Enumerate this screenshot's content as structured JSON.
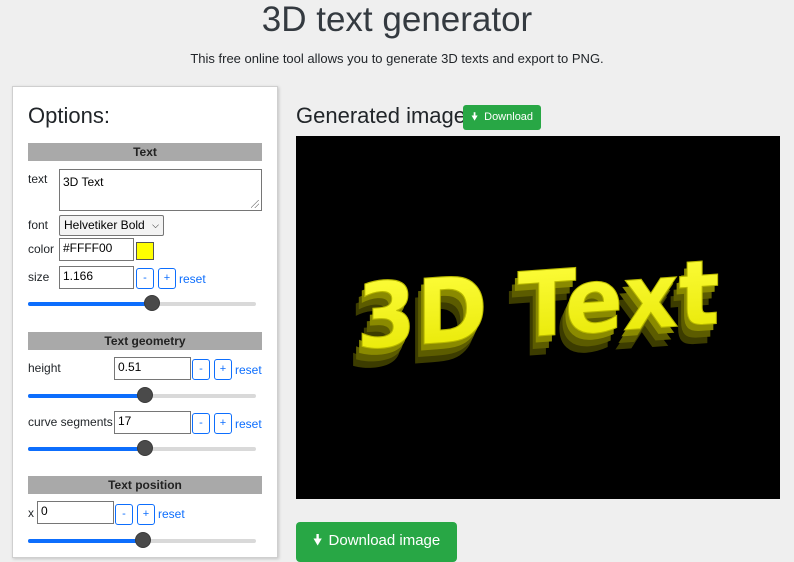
{
  "header": {
    "title": "3D text generator",
    "subtitle": "This free online tool allows you to generate 3D texts and export to PNG."
  },
  "options": {
    "heading": "Options:",
    "sections": {
      "text": "Text",
      "geometry": "Text geometry",
      "position": "Text position"
    },
    "text": {
      "label": "text",
      "value": "3D Text"
    },
    "font": {
      "label": "font",
      "value": "Helvetiker Bold"
    },
    "color": {
      "label": "color",
      "value": "#FFFF00",
      "swatch": "#FFFF00"
    },
    "size": {
      "label": "size",
      "value": "1.166",
      "slider_fraction": 0.54
    },
    "height": {
      "label": "height",
      "value": "0.51",
      "slider_fraction": 0.51
    },
    "curve_segments": {
      "label": "curve segments",
      "value": "17",
      "slider_fraction": 0.51
    },
    "x": {
      "label": "x",
      "value": "0",
      "slider_fraction": 0.5
    },
    "minus": "-",
    "plus": "+",
    "reset": "reset"
  },
  "generated": {
    "title": "Generated image",
    "download_small": "Download",
    "download_large": "Download image",
    "rendered_text": "3D Text",
    "text_color": "#FFFF00",
    "background": "#000000",
    "button_color": "#28a745"
  }
}
